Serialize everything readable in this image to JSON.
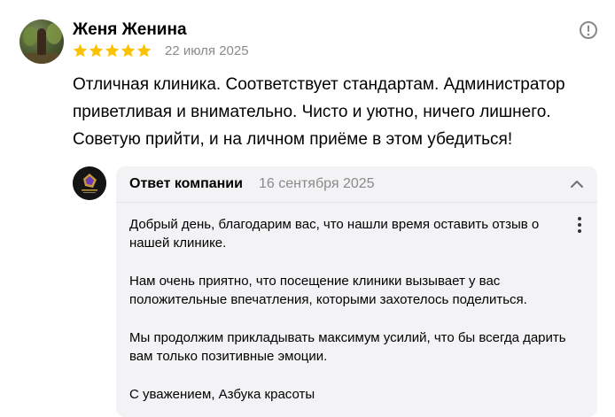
{
  "review": {
    "author": "Женя Женина",
    "rating": 5,
    "date": "22 июля 2025",
    "text": "Отличная клиника. Соответствует стандартам. Администратор приветливая и внимательно. Чисто и уютно, ничего лишнего. Советую прийти, и на личном приёме в этом убедиться!"
  },
  "reply": {
    "title": "Ответ компании",
    "date": "16 сентября 2025",
    "paragraphs": [
      "Добрый день, благодарим вас, что нашли время оставить отзыв о нашей клинике.",
      "Нам очень приятно, что посещение клиники вызывает у вас положительные впечатления, которыми захотелось поделиться.",
      "Мы продолжим прикладывать максимум усилий, что бы всегда дарить вам только позитивные эмоции.",
      "С уважением, Азбука красоты"
    ]
  },
  "colors": {
    "star": "#fcc200",
    "muted": "#8a8a8a",
    "reply_bg": "#f3f3f5"
  },
  "icons": {
    "info": "exclamation-circle-icon",
    "collapse": "chevron-up-icon",
    "more": "vertical-dots-icon"
  }
}
